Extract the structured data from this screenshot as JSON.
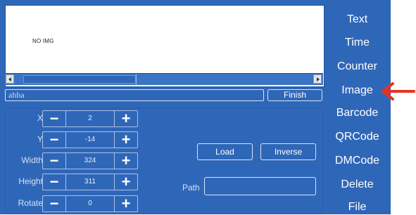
{
  "preview": {
    "placeholder": "NO IMG"
  },
  "text_field": {
    "value": "ahha"
  },
  "finish_label": "Finish",
  "properties": [
    {
      "key": "x",
      "label": "X",
      "value": "2"
    },
    {
      "key": "y",
      "label": "Y",
      "value": "-14"
    },
    {
      "key": "width",
      "label": "Width",
      "value": "324"
    },
    {
      "key": "height",
      "label": "Height",
      "value": "311"
    },
    {
      "key": "rotate",
      "label": "Rotate",
      "value": "0"
    }
  ],
  "stepper_symbols": {
    "minus": "−",
    "plus": "+"
  },
  "actions": {
    "load_label": "Load",
    "inverse_label": "Inverse"
  },
  "path": {
    "label": "Path",
    "value": ""
  },
  "menu": {
    "items": [
      "Text",
      "Time",
      "Counter",
      "Image",
      "Barcode",
      "QRCode",
      "DMCode",
      "Delete",
      "File"
    ],
    "active": "Image"
  },
  "colors": {
    "panel_bg": "#2f67b8",
    "annotation_arrow": "#e8321e"
  },
  "icons": {
    "annotation": "red-arrow-left-icon"
  }
}
